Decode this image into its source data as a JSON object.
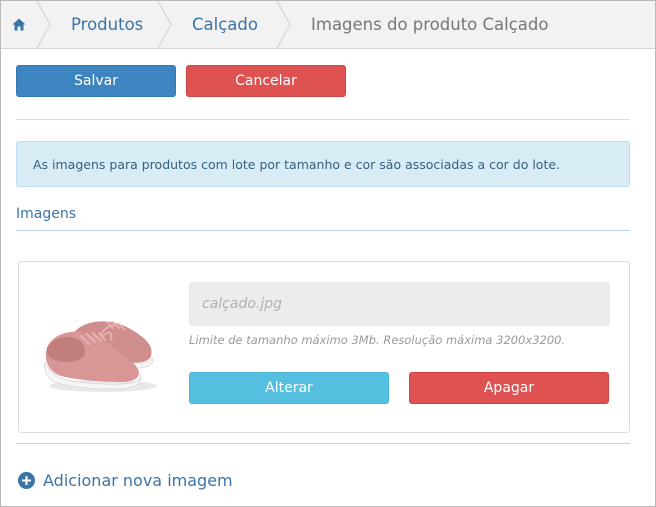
{
  "breadcrumb": {
    "home_icon": "home-icon",
    "items": [
      "Produtos",
      "Calçado",
      "Imagens do produto Calçado"
    ]
  },
  "toolbar": {
    "save_label": "Salvar",
    "cancel_label": "Cancelar"
  },
  "alert": {
    "text": "As imagens para produtos com lote por tamanho e cor são associadas a cor do lote."
  },
  "images_section": {
    "title": "Imagens",
    "items": [
      {
        "thumbnail": "pink-sneaker-image",
        "file_placeholder": "calçado.jpg",
        "hint": "Limite de tamanho máximo 3Mb. Resolução máxima 3200x3200.",
        "change_label": "Alterar",
        "delete_label": "Apagar"
      }
    ],
    "add_label": "Adicionar nova imagem",
    "add_icon": "plus-circle-icon"
  },
  "colors": {
    "primary": "#3d85c0",
    "danger": "#df5252",
    "info": "#55c0e0",
    "link": "#3a74a8",
    "alert_bg": "#d8ecf6"
  }
}
